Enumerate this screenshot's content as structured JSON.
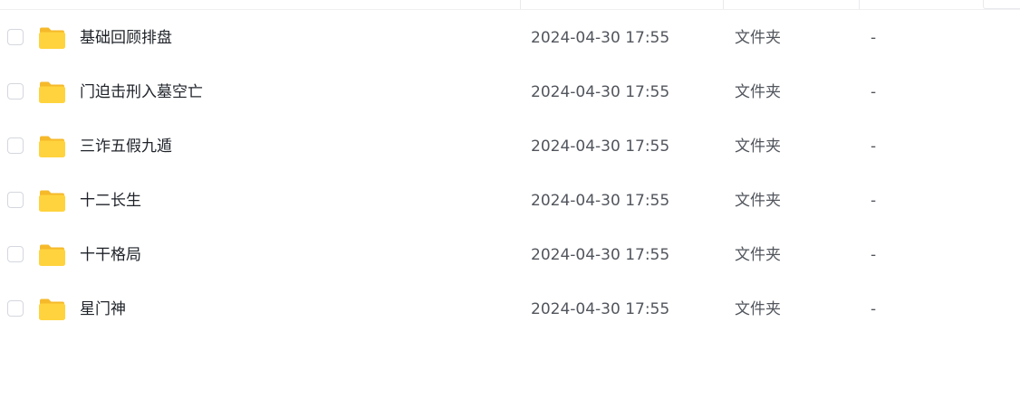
{
  "files": [
    {
      "name": "基础回顾排盘",
      "modified": "2024-04-30 17:55",
      "type": "文件夹",
      "size": "-",
      "icon": "folder-icon"
    },
    {
      "name": "门迫击刑入墓空亡",
      "modified": "2024-04-30 17:55",
      "type": "文件夹",
      "size": "-",
      "icon": "folder-icon"
    },
    {
      "name": "三诈五假九遁",
      "modified": "2024-04-30 17:55",
      "type": "文件夹",
      "size": "-",
      "icon": "folder-icon"
    },
    {
      "name": "十二长生",
      "modified": "2024-04-30 17:55",
      "type": "文件夹",
      "size": "-",
      "icon": "folder-icon"
    },
    {
      "name": "十干格局",
      "modified": "2024-04-30 17:55",
      "type": "文件夹",
      "size": "-",
      "icon": "folder-icon"
    },
    {
      "name": "星门神",
      "modified": "2024-04-30 17:55",
      "type": "文件夹",
      "size": "-",
      "icon": "folder-icon"
    }
  ],
  "colors": {
    "folder_body": "#ffd33d",
    "folder_tab": "#f5b92a",
    "text_primary": "#1f2329",
    "text_secondary": "#51555c",
    "checkbox_border": "#d4d7de"
  }
}
